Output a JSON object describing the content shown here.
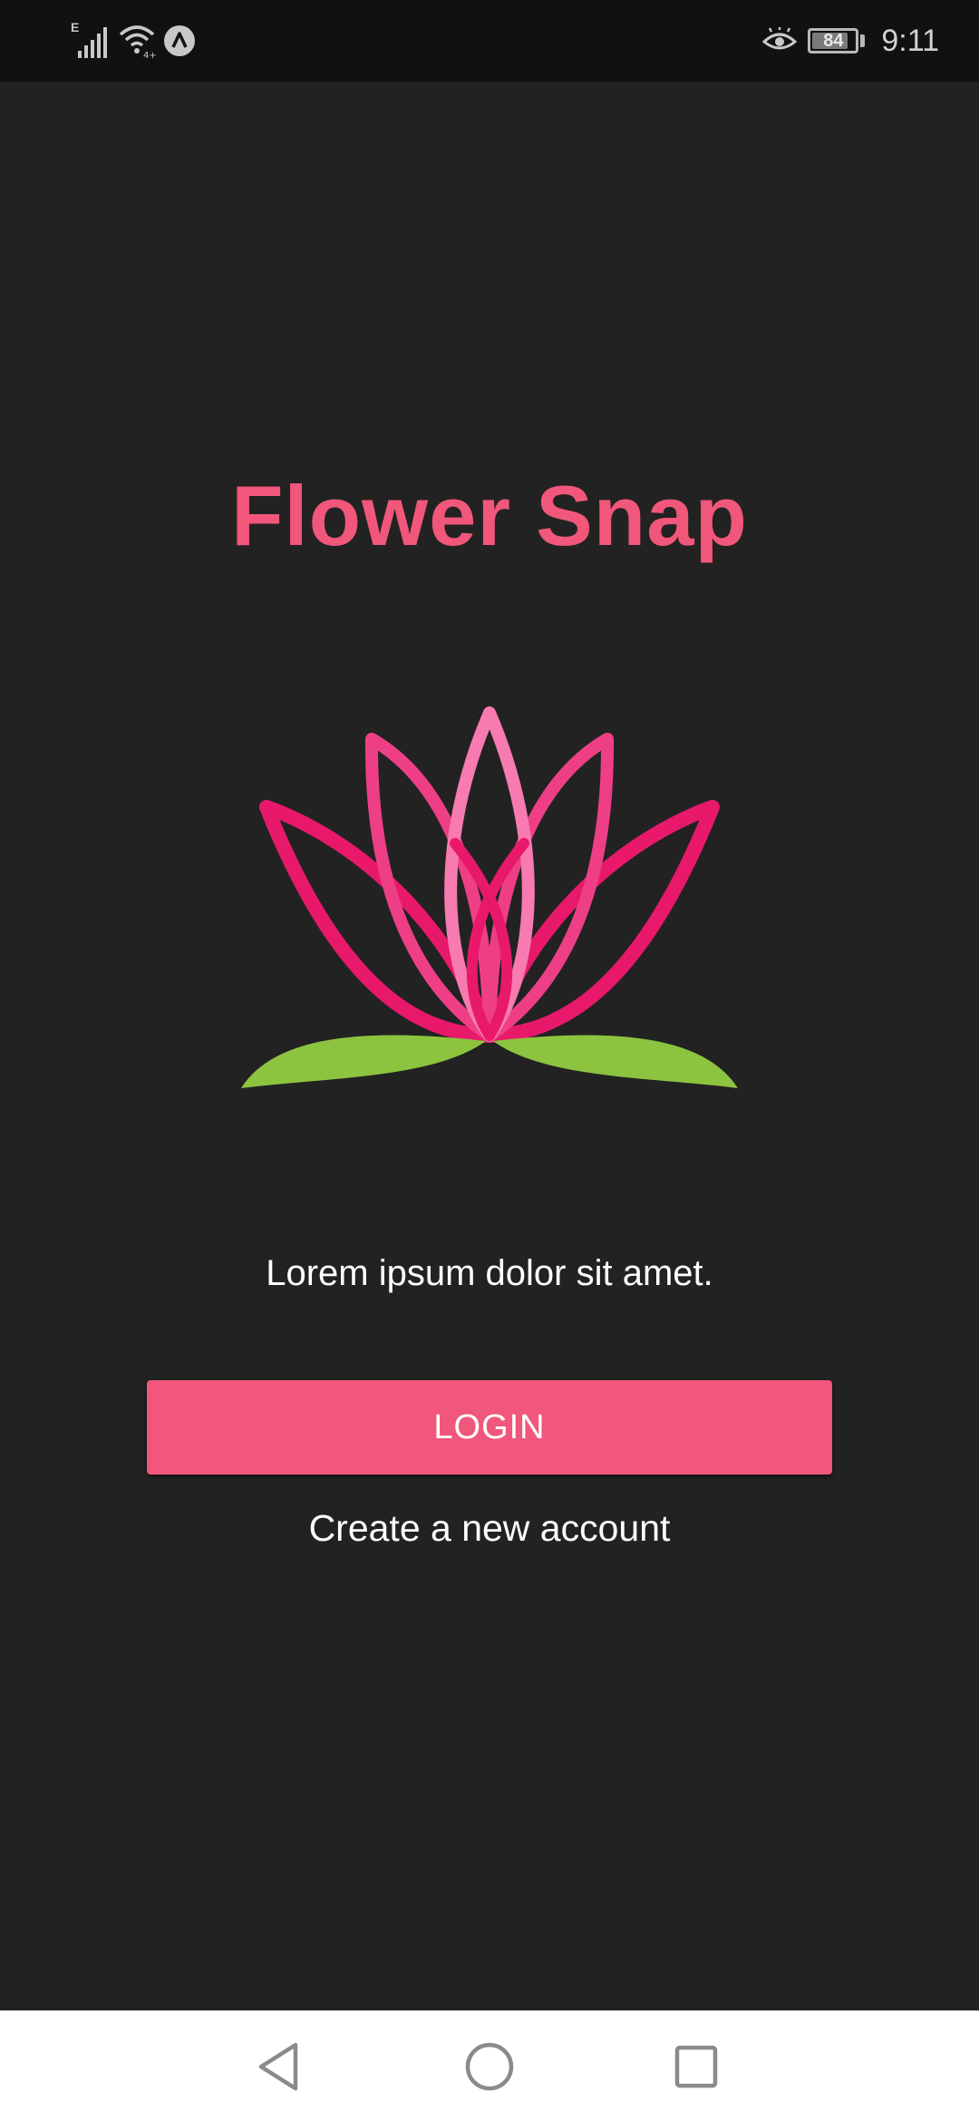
{
  "status_bar": {
    "network_label": "E",
    "time": "9:11",
    "battery_level": "84",
    "battery_fraction": 0.84,
    "icons": [
      "signal-icon",
      "wifi-icon",
      "app-notification-icon",
      "eye-comfort-icon",
      "battery-icon"
    ]
  },
  "app": {
    "title": "Flower Snap",
    "tagline": "Lorem ipsum dolor sit amet.",
    "login_label": "LOGIN",
    "create_account_label": "Create a new account"
  },
  "colors": {
    "background": "#222222",
    "accent": "#f0577a",
    "petal_dark": "#e8196a",
    "petal_light": "#f77bb0",
    "leaf": "#8cc43f",
    "nav_bar": "#ffffff"
  },
  "nav": {
    "icons": [
      "back-icon",
      "home-icon",
      "recents-icon"
    ]
  }
}
